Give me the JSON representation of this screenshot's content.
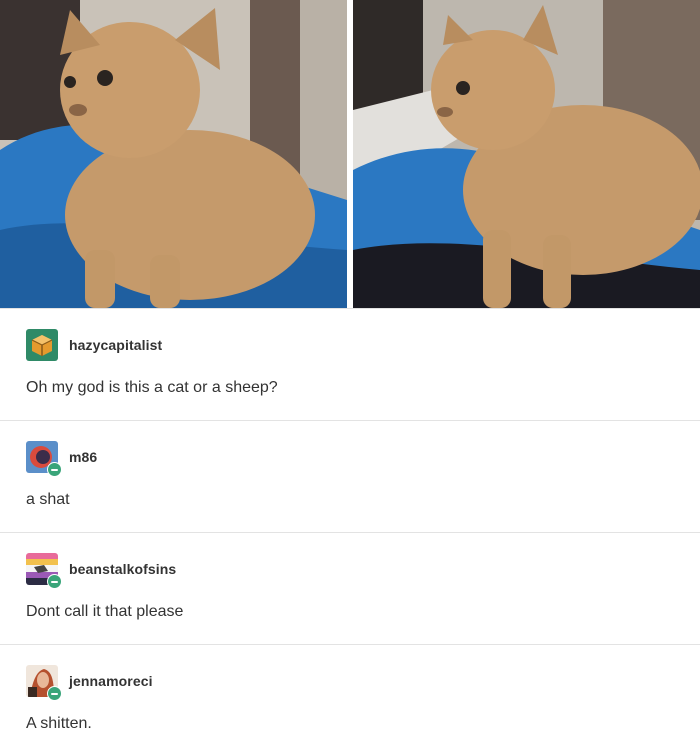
{
  "thread": {
    "images": [
      {
        "icon": "kitten-photo-left"
      },
      {
        "icon": "kitten-photo-right"
      }
    ],
    "replies": [
      {
        "username": "hazycapitalist",
        "text": "Oh my god is this a cat or a sheep?",
        "avatar": "box-avatar",
        "badge": false
      },
      {
        "username": "m86",
        "text": "a shat",
        "avatar": "blue-circle-avatar",
        "badge": true
      },
      {
        "username": "beanstalkofsins",
        "text": "Dont call it that please",
        "avatar": "pride-avatar",
        "badge": true
      },
      {
        "username": "jennamoreci",
        "text": "A shitten.",
        "avatar": "portrait-avatar",
        "badge": true
      }
    ]
  },
  "colors": {
    "badge": "#3aa57a",
    "separator": "#e3e3e3",
    "text": "#333333"
  }
}
